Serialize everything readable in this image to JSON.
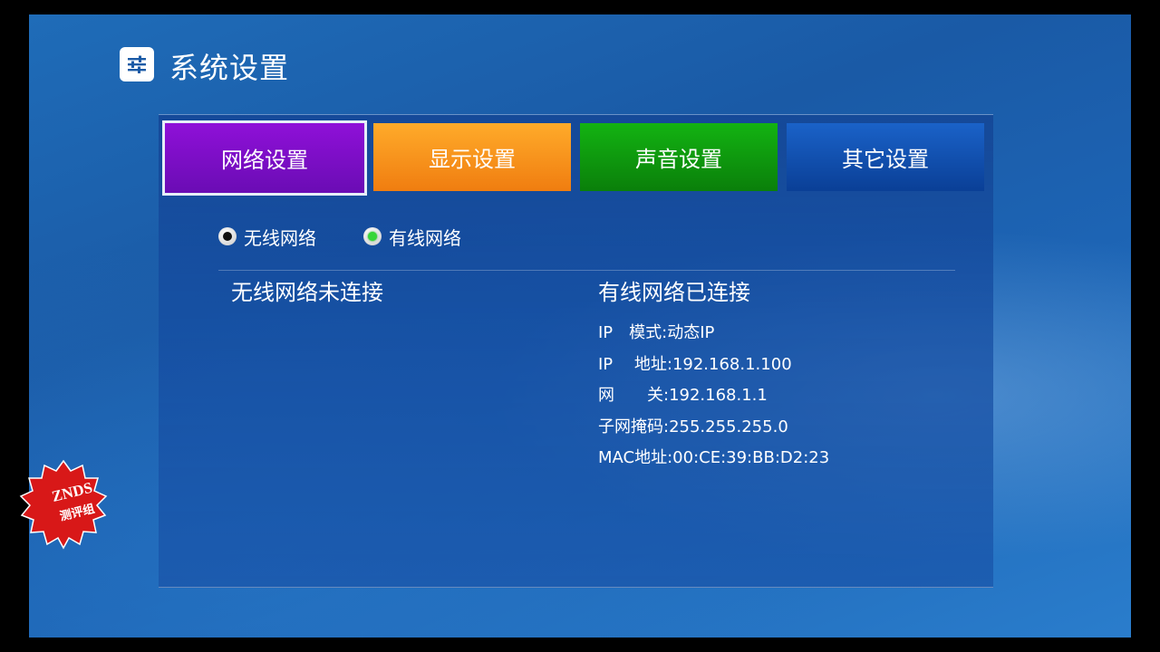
{
  "header": {
    "title": "系统设置",
    "icon": "sliders-icon"
  },
  "tabs": [
    {
      "label": "网络设置",
      "color": "#7a0ec6",
      "selected": true
    },
    {
      "label": "显示设置",
      "color": "#f7921c",
      "selected": false
    },
    {
      "label": "声音设置",
      "color": "#0f990f",
      "selected": false
    },
    {
      "label": "其它设置",
      "color": "#1250b0",
      "selected": false
    }
  ],
  "network_type": {
    "options": [
      {
        "label": "无线网络",
        "checked": false
      },
      {
        "label": "有线网络",
        "checked": true
      }
    ]
  },
  "wireless": {
    "status": "无线网络未连接"
  },
  "wired": {
    "status": "有线网络已连接",
    "info": [
      {
        "label": "IP　模式: ",
        "value": "动态IP"
      },
      {
        "label": "IP　 地址: ",
        "value": "192.168.1.100"
      },
      {
        "label": "网　　关: ",
        "value": "192.168.1.1"
      },
      {
        "label": "子网掩码: ",
        "value": "255.255.255.0"
      },
      {
        "label": "MAC地址: ",
        "value": "00:CE:39:BB:D2:23"
      }
    ]
  },
  "watermark": {
    "line1": "ZNDS",
    "line2": "测评组",
    "color": "#d81818"
  }
}
